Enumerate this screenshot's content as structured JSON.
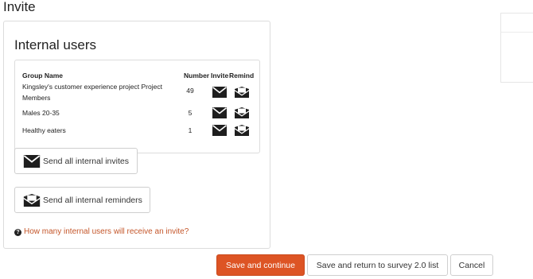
{
  "page": {
    "title": "Invite"
  },
  "internal_users": {
    "title": "Internal users",
    "table": {
      "headers": {
        "group_name": "Group Name",
        "number": "Number",
        "invite": "Invite",
        "remind": "Remind"
      },
      "rows": [
        {
          "group_name": "Kingsley's customer experience project Project Members",
          "number": "49",
          "invite_icon": "envelope-icon",
          "remind_icon": "open-envelope-icon"
        },
        {
          "group_name": "Males 20-35",
          "number": "5",
          "invite_icon": "envelope-icon",
          "remind_icon": "open-envelope-icon"
        },
        {
          "group_name": "Healthy eaters",
          "number": "1",
          "invite_icon": "envelope-icon",
          "remind_icon": "open-envelope-icon"
        }
      ]
    },
    "send_invites_label": "Send all internal invites",
    "send_reminders_label": "Send all internal reminders",
    "help": {
      "icon": "question-circle-icon",
      "text": "How many internal users will receive an invite?"
    }
  },
  "footer": {
    "save_continue": "Save and continue",
    "save_return": "Save and return to survey 2.0 list",
    "cancel": "Cancel"
  },
  "colors": {
    "primary": "#dd5424",
    "link": "#c4562a",
    "border": "#dcdcdc"
  }
}
